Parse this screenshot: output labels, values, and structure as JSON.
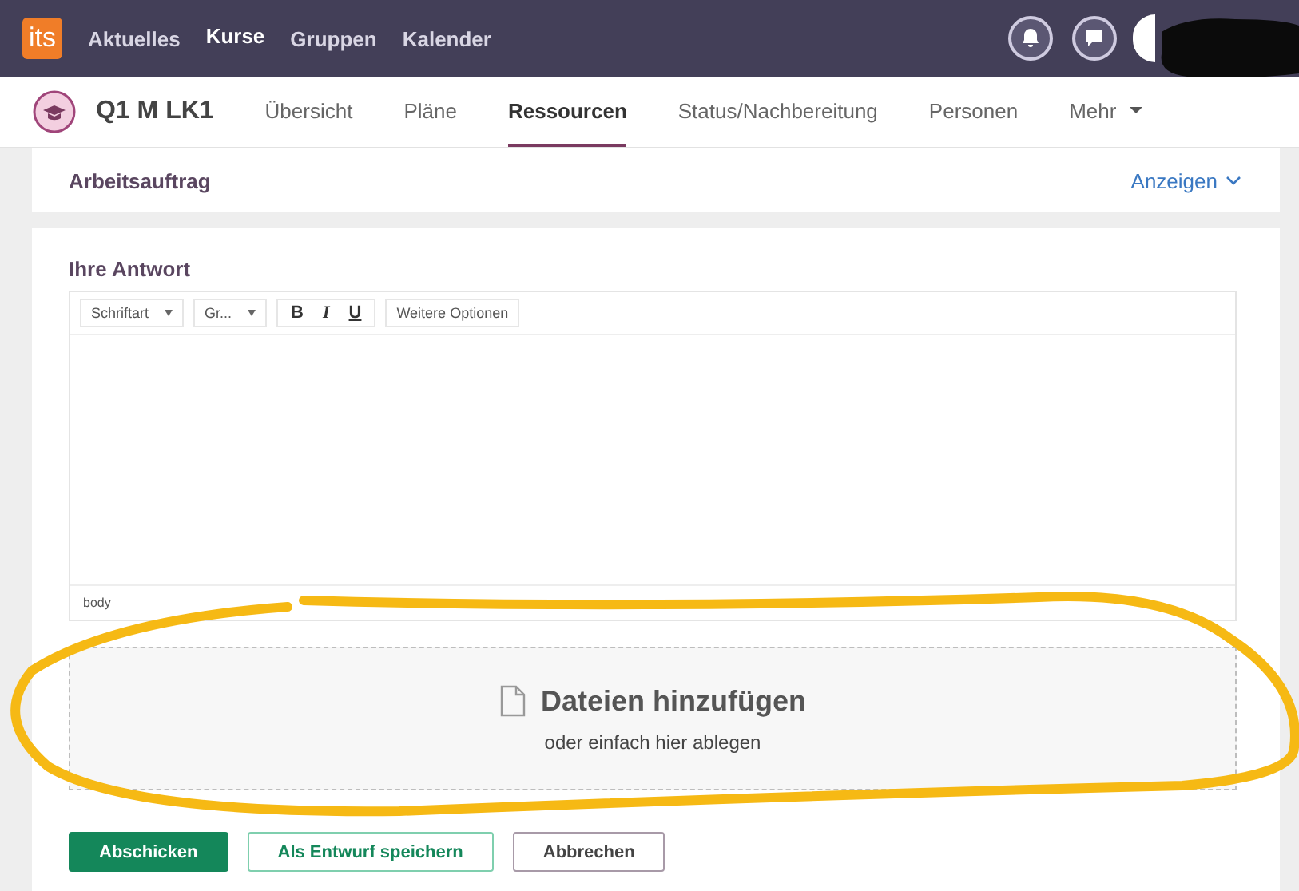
{
  "topbar": {
    "logo": "its",
    "nav": [
      {
        "label": "Aktuelles",
        "selected": false
      },
      {
        "label": "Kurse",
        "selected": true
      },
      {
        "label": "Gruppen",
        "selected": false
      },
      {
        "label": "Kalender",
        "selected": false
      }
    ]
  },
  "course": {
    "title": "Q1 M LK1",
    "tabs": [
      {
        "label": "Übersicht",
        "selected": false
      },
      {
        "label": "Pläne",
        "selected": false
      },
      {
        "label": "Ressourcen",
        "selected": true
      },
      {
        "label": "Status/Nachbereitung",
        "selected": false
      },
      {
        "label": "Personen",
        "selected": false
      },
      {
        "label": "Mehr",
        "selected": false,
        "dropdown": true
      }
    ]
  },
  "task": {
    "title": "Arbeitsauftrag",
    "toggle": "Anzeigen"
  },
  "answer": {
    "title": "Ihre Antwort",
    "toolbar": {
      "font": "Schriftart",
      "size": "Gr...",
      "bold": "B",
      "italic": "I",
      "underline": "U",
      "more": "Weitere Optionen"
    },
    "status": "body",
    "dropzone": {
      "title": "Dateien hinzufügen",
      "hint": "oder einfach hier ablegen"
    }
  },
  "buttons": [
    {
      "label": "Abschicken",
      "kind": "primary"
    },
    {
      "label": "Als Entwurf speichern",
      "kind": "secondary"
    },
    {
      "label": "Abbrechen",
      "kind": "neutral"
    }
  ]
}
